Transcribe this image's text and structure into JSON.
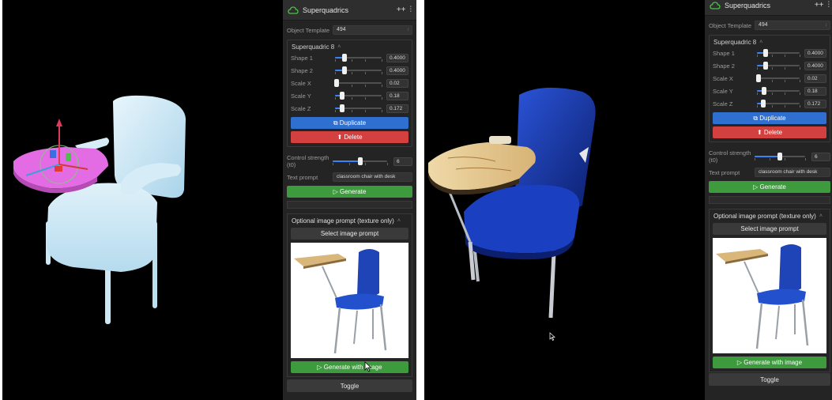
{
  "panel": {
    "title": "Superquadrics",
    "object_template_label": "Object Template",
    "object_template_value": "494",
    "group_title": "Superquadric 8",
    "sliders": [
      {
        "label": "Shape 1",
        "value": "0.4000",
        "fraction": 0.2
      },
      {
        "label": "Shape 2",
        "value": "0.4000",
        "fraction": 0.2
      },
      {
        "label": "Scale X",
        "value": "0.02",
        "fraction": 0.03
      },
      {
        "label": "Scale Y",
        "value": "0.18",
        "fraction": 0.16
      },
      {
        "label": "Scale Z",
        "value": "0.172",
        "fraction": 0.15
      }
    ],
    "duplicate_label": "Duplicate",
    "delete_label": "Delete",
    "control_strength_label": "Control strength (t0)",
    "control_strength_value": "6",
    "control_strength_fraction": 0.5,
    "text_prompt_label": "Text prompt",
    "text_prompt_value": "classroom chair with desk",
    "generate_label": "Generate",
    "image_prompt_title": "Optional image prompt (texture only)",
    "select_image_label": "Select image prompt",
    "generate_with_image_label": "Generate with image",
    "toggle_label": "Toggle"
  },
  "colors": {
    "panel_bg": "#242424",
    "accent_blue": "#2f6fd0",
    "danger_red": "#d24040",
    "success_green": "#3d9a3d",
    "gizmo_magenta": "#e05ce0",
    "chair_blue": "#1a3fb0",
    "chair_shape": "#cfe8f5"
  },
  "icons": {
    "cloud": "cloud-icon",
    "share": "share-icon",
    "sliders": "sliders-icon",
    "duplicate": "copy-icon",
    "delete": "trash-icon",
    "play": "play-icon"
  }
}
